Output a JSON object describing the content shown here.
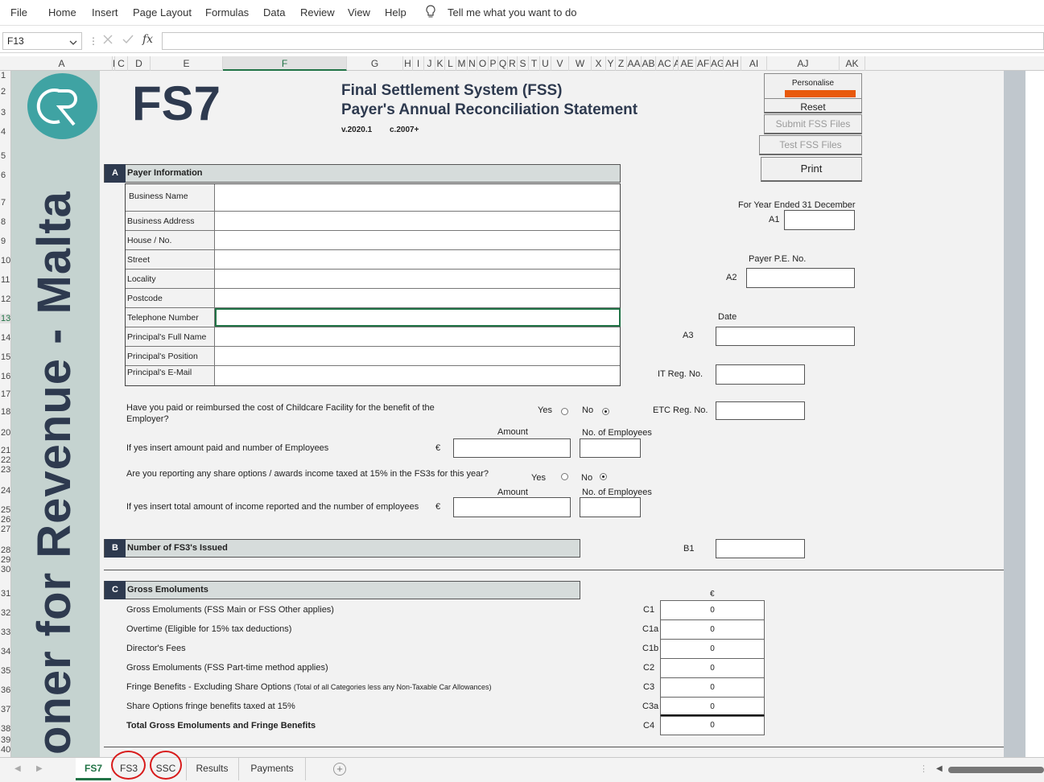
{
  "menu": {
    "file": "File",
    "home": "Home",
    "insert": "Insert",
    "page_layout": "Page Layout",
    "formulas": "Formulas",
    "data": "Data",
    "review": "Review",
    "view": "View",
    "help": "Help",
    "tell_me": "Tell me what you want to do"
  },
  "formula_bar": {
    "name_box": "F13",
    "fx": "fx",
    "formula": ""
  },
  "columns": [
    "A",
    "B",
    "C",
    "D",
    "E",
    "F",
    "G",
    "H",
    "I",
    "J",
    "K",
    "L",
    "M",
    "N",
    "O",
    "P",
    "Q",
    "R",
    "S",
    "T",
    "U",
    "V",
    "W",
    "X",
    "Y",
    "Z",
    "AA",
    "AB",
    "AC",
    "AD",
    "AE",
    "AF",
    "AG",
    "AH",
    "AI",
    "AJ",
    "AK"
  ],
  "rows": [
    "1",
    "2",
    "3",
    "4",
    "5",
    "6",
    "7",
    "8",
    "9",
    "10",
    "11",
    "12",
    "13",
    "14",
    "15",
    "16",
    "17",
    "18",
    "20",
    "21",
    "22",
    "23",
    "24",
    "25",
    "26",
    "27",
    "28",
    "29",
    "30",
    "31",
    "32",
    "33",
    "34",
    "35",
    "36",
    "37",
    "38",
    "39",
    "40"
  ],
  "header": {
    "logo_text": "CR",
    "vertical": "oner for Revenue - Malta",
    "fs7": "FS7",
    "title1": "Final Settlement System (FSS)",
    "title2": "Payer's Annual Reconciliation Statement",
    "version": "v.2020.1",
    "c": "c.2007+"
  },
  "buttons": {
    "personalise": "Personalise",
    "reset": "Reset",
    "submit": "Submit FSS Files",
    "test": "Test FSS Files",
    "print": "Print"
  },
  "section_a": {
    "letter": "A",
    "title": "Payer Information",
    "rows": [
      "Business Name",
      "Business Address",
      "House / No.",
      "Street",
      "Locality",
      "Postcode",
      "Telephone Number",
      "Principal's Full Name",
      "Principal's Position",
      "Principal's E-Mail"
    ]
  },
  "right_fields": {
    "year_label": "For Year Ended 31 December",
    "a1": "A1",
    "pe_label": "Payer P.E. No.",
    "a2": "A2",
    "date_label": "Date",
    "a3": "A3",
    "it_reg": "IT Reg. No.",
    "etc_reg": "ETC Reg. No."
  },
  "questions": {
    "q1a": "Have you paid or reimbursed the cost of Childcare Facility for the benefit of the",
    "q1b": "Employer?",
    "yes": "Yes",
    "no": "No",
    "amount": "Amount",
    "no_emp": "No. of Employees",
    "q1_insert": "If yes insert amount paid and number of Employees",
    "euro": "€",
    "q2": "Are you reporting any share options / awards income taxed at 15% in the FS3s for this year?",
    "q2_insert": "If yes insert total amount of income reported and the number of employees"
  },
  "section_b": {
    "letter": "B",
    "title": "Number of FS3's Issued",
    "b1": "B1"
  },
  "section_c": {
    "letter": "C",
    "title": "Gross Emoluments",
    "euro": "€",
    "rows": [
      {
        "label": "Gross Emoluments (FSS Main or FSS Other applies)",
        "code": "C1",
        "value": "0"
      },
      {
        "label": "Overtime (Eligible for 15% tax deductions)",
        "code": "C1a",
        "value": "0"
      },
      {
        "label": "Director's Fees",
        "code": "C1b",
        "value": "0"
      },
      {
        "label": "Gross Emoluments (FSS Part-time method applies)",
        "code": "C2",
        "value": "0"
      },
      {
        "label": "Fringe Benefits - Excluding Share Options",
        "code": "C3",
        "value": "0"
      },
      {
        "label": "Share Options fringe benefits taxed at 15%",
        "code": "C3a",
        "value": "0"
      },
      {
        "label": "Total Gross Emoluments and Fringe Benefits",
        "code": "C4",
        "value": "0"
      }
    ],
    "fringe_note": "(Total of all Categories less any Non-Taxable Car Allowances)"
  },
  "tabs": {
    "fs7": "FS7",
    "fs3": "FS3",
    "ssc": "SSC",
    "results": "Results",
    "payments": "Payments",
    "add": "+"
  }
}
